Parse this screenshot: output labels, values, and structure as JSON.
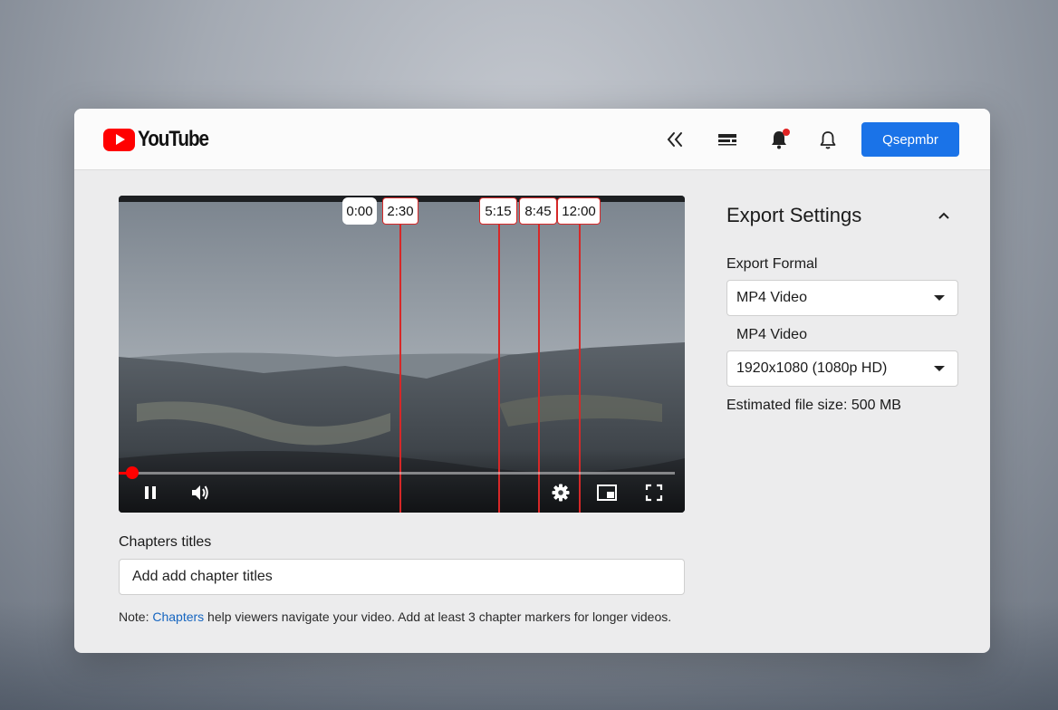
{
  "app": {
    "logo_text": "YouTube",
    "accent": "#ff0000",
    "primary": "#1a73e8"
  },
  "header": {
    "icons": [
      "sparkle-icon",
      "captions-icon",
      "notification-filled-icon",
      "bell-icon"
    ],
    "action_button_label": "Qsepmbr"
  },
  "player": {
    "chapter_markers": [
      "0:00",
      "2:30",
      "5:15",
      "8:45",
      "12:00"
    ],
    "progress_fraction": 0.025,
    "controls": [
      "pause-icon",
      "volume-icon",
      "settings-icon",
      "miniplayer-icon",
      "fullscreen-icon"
    ]
  },
  "chapters": {
    "label": "Chapters titles",
    "input_value": "Add add chapter titles",
    "note_prefix": "Note: ",
    "note_link": "Chapters",
    "note_suffix": " help viewers navigate your video. Add at least 3 chapter markers for longer videos."
  },
  "export": {
    "title": "Export Settings",
    "format_label": "Export Formal",
    "format_value": "MP4 Video",
    "format_sublabel": "MP4 Video",
    "resolution_value": "1920x1080 (1080p HD)",
    "file_size_text": "Estimated file size: 500 MB"
  }
}
